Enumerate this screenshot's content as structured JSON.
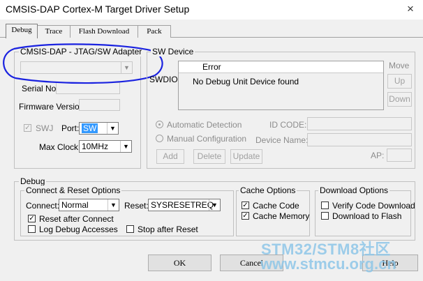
{
  "window": {
    "title": "CMSIS-DAP Cortex-M Target Driver Setup",
    "close_icon": "×"
  },
  "tabs": [
    {
      "label": "Debug",
      "active": true
    },
    {
      "label": "Trace",
      "active": false
    },
    {
      "label": "Flash Download",
      "active": false
    },
    {
      "label": "Pack",
      "active": false
    }
  ],
  "adapter": {
    "group_label": "CMSIS-DAP - JTAG/SW Adapter",
    "serial_label": "Serial No:",
    "firmware_label": "Firmware Version:",
    "swj_label": "SWJ",
    "port_label": "Port:",
    "port_value": "SW",
    "maxclock_label": "Max Clock:",
    "maxclock_value": "10MHz"
  },
  "sw_device": {
    "group_label": "SW Device",
    "swdio_label": "SWDIO",
    "col_error": "Error",
    "row_text": "No Debug Unit Device found",
    "move_label": "Move",
    "up_label": "Up",
    "down_label": "Down",
    "auto_detect_label": "Automatic Detection",
    "manual_config_label": "Manual Configuration",
    "id_code_label": "ID CODE:",
    "device_name_label": "Device Name:",
    "add_label": "Add",
    "delete_label": "Delete",
    "update_label": "Update",
    "ap_label": "AP:"
  },
  "debug": {
    "group_label": "Debug",
    "connect_reset_label": "Connect & Reset Options",
    "connect_label": "Connect:",
    "connect_value": "Normal",
    "reset_label": "Reset:",
    "reset_value": "SYSRESETREQ",
    "reset_after_connect_label": "Reset after Connect",
    "log_debug_label": "Log Debug Accesses",
    "stop_after_reset_label": "Stop after Reset",
    "cache_options_label": "Cache Options",
    "cache_code_label": "Cache Code",
    "cache_memory_label": "Cache Memory",
    "download_options_label": "Download Options",
    "verify_download_label": "Verify Code Download",
    "download_flash_label": "Download to Flash"
  },
  "footer": {
    "ok_label": "OK",
    "cancel_label": "Cancel",
    "help_label": "Help"
  },
  "watermark": {
    "line1": "STM32/STM8社区",
    "line2": "www.stmcu.org.cn"
  },
  "colors": {
    "annotation_ellipse": "#1a22e0",
    "selection": "#3399ff",
    "watermark": "#8ec6e8"
  }
}
